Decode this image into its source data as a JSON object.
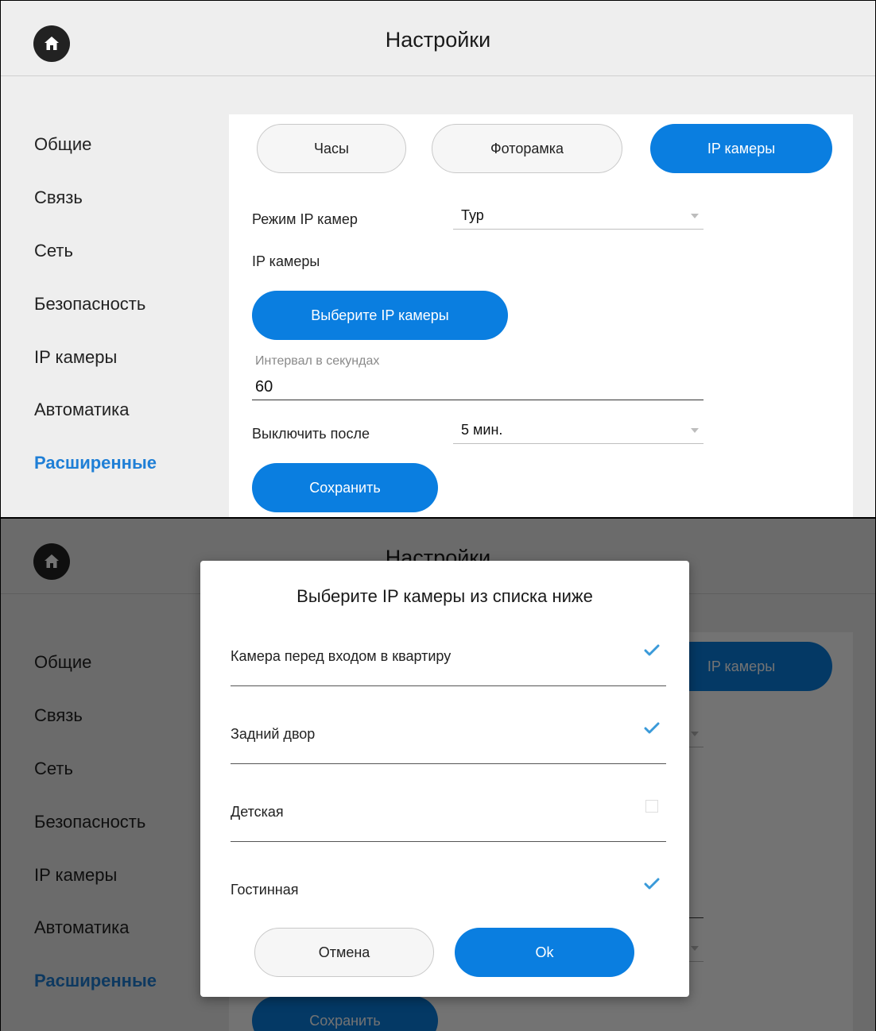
{
  "header": {
    "title": "Настройки",
    "home_icon": "home-icon"
  },
  "sidebar": {
    "items": [
      {
        "label": "Общие"
      },
      {
        "label": "Связь"
      },
      {
        "label": "Сеть"
      },
      {
        "label": "Безопасность"
      },
      {
        "label": "IP камеры"
      },
      {
        "label": "Автоматика"
      },
      {
        "label": "Расширенные",
        "active": true
      }
    ]
  },
  "tabs": [
    {
      "label": "Часы"
    },
    {
      "label": "Фоторамка"
    },
    {
      "label": "IP камеры",
      "active": true
    }
  ],
  "form": {
    "mode_label": "Режим IP камер",
    "mode_value": "Тур",
    "cameras_label": "IP камеры",
    "select_button": "Выберите IP камеры",
    "interval_hint": "Интервал в секундах",
    "interval_value": "60",
    "off_label": "Выключить после",
    "off_value": "5 мин.",
    "save_button": "Сохранить"
  },
  "dialog": {
    "title": "Выберите IP камеры из списка ниже",
    "cameras": [
      {
        "name": "Камера перед входом в квартиру",
        "checked": true
      },
      {
        "name": "Задний двор",
        "checked": true
      },
      {
        "name": "Детская",
        "checked": false
      },
      {
        "name": "Гостинная",
        "checked": true
      }
    ],
    "cancel_button": "Отмена",
    "ok_button": "Ok"
  },
  "colors": {
    "accent": "#0a7ee0",
    "active_text": "#1f7fd6",
    "background": "#eeeeee"
  }
}
